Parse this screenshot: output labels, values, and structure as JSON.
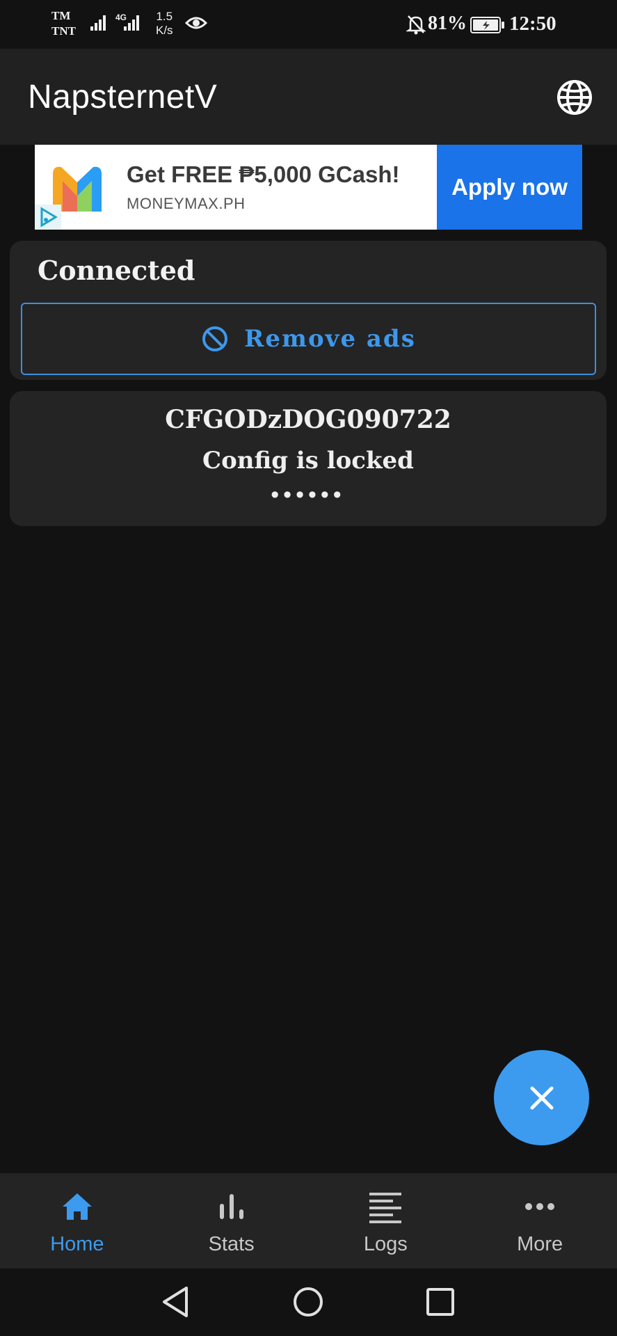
{
  "status_bar": {
    "carrier_1": "TM",
    "carrier_2": "TNT",
    "network_type": "4G",
    "speed_value": "1.5",
    "speed_unit": "K/s",
    "battery_percent": "81%",
    "time": "12:50"
  },
  "app_bar": {
    "title": "NapsternetV",
    "action_icon": "globe-icon"
  },
  "ad": {
    "title": "Get FREE ₱5,000 GCash!",
    "domain": "MONEYMAX.PH",
    "cta_label": "Apply now",
    "cta_color": "#1a73e8"
  },
  "status_card": {
    "status": "Connected",
    "remove_ads_label": "Remove ads"
  },
  "config_card": {
    "name": "CFGODzDOG090722",
    "lock_message": "Config is locked",
    "masked_value": "••••••"
  },
  "fab": {
    "icon": "close-icon",
    "color": "#3c9bef"
  },
  "bottom_nav": {
    "items": [
      {
        "label": "Home",
        "icon": "home-icon",
        "active": true
      },
      {
        "label": "Stats",
        "icon": "bar-chart-icon",
        "active": false
      },
      {
        "label": "Logs",
        "icon": "list-icon",
        "active": false
      },
      {
        "label": "More",
        "icon": "more-dots-icon",
        "active": false
      }
    ]
  },
  "system_nav": {
    "buttons": [
      "back-icon",
      "home-circle-icon",
      "recents-icon"
    ]
  }
}
